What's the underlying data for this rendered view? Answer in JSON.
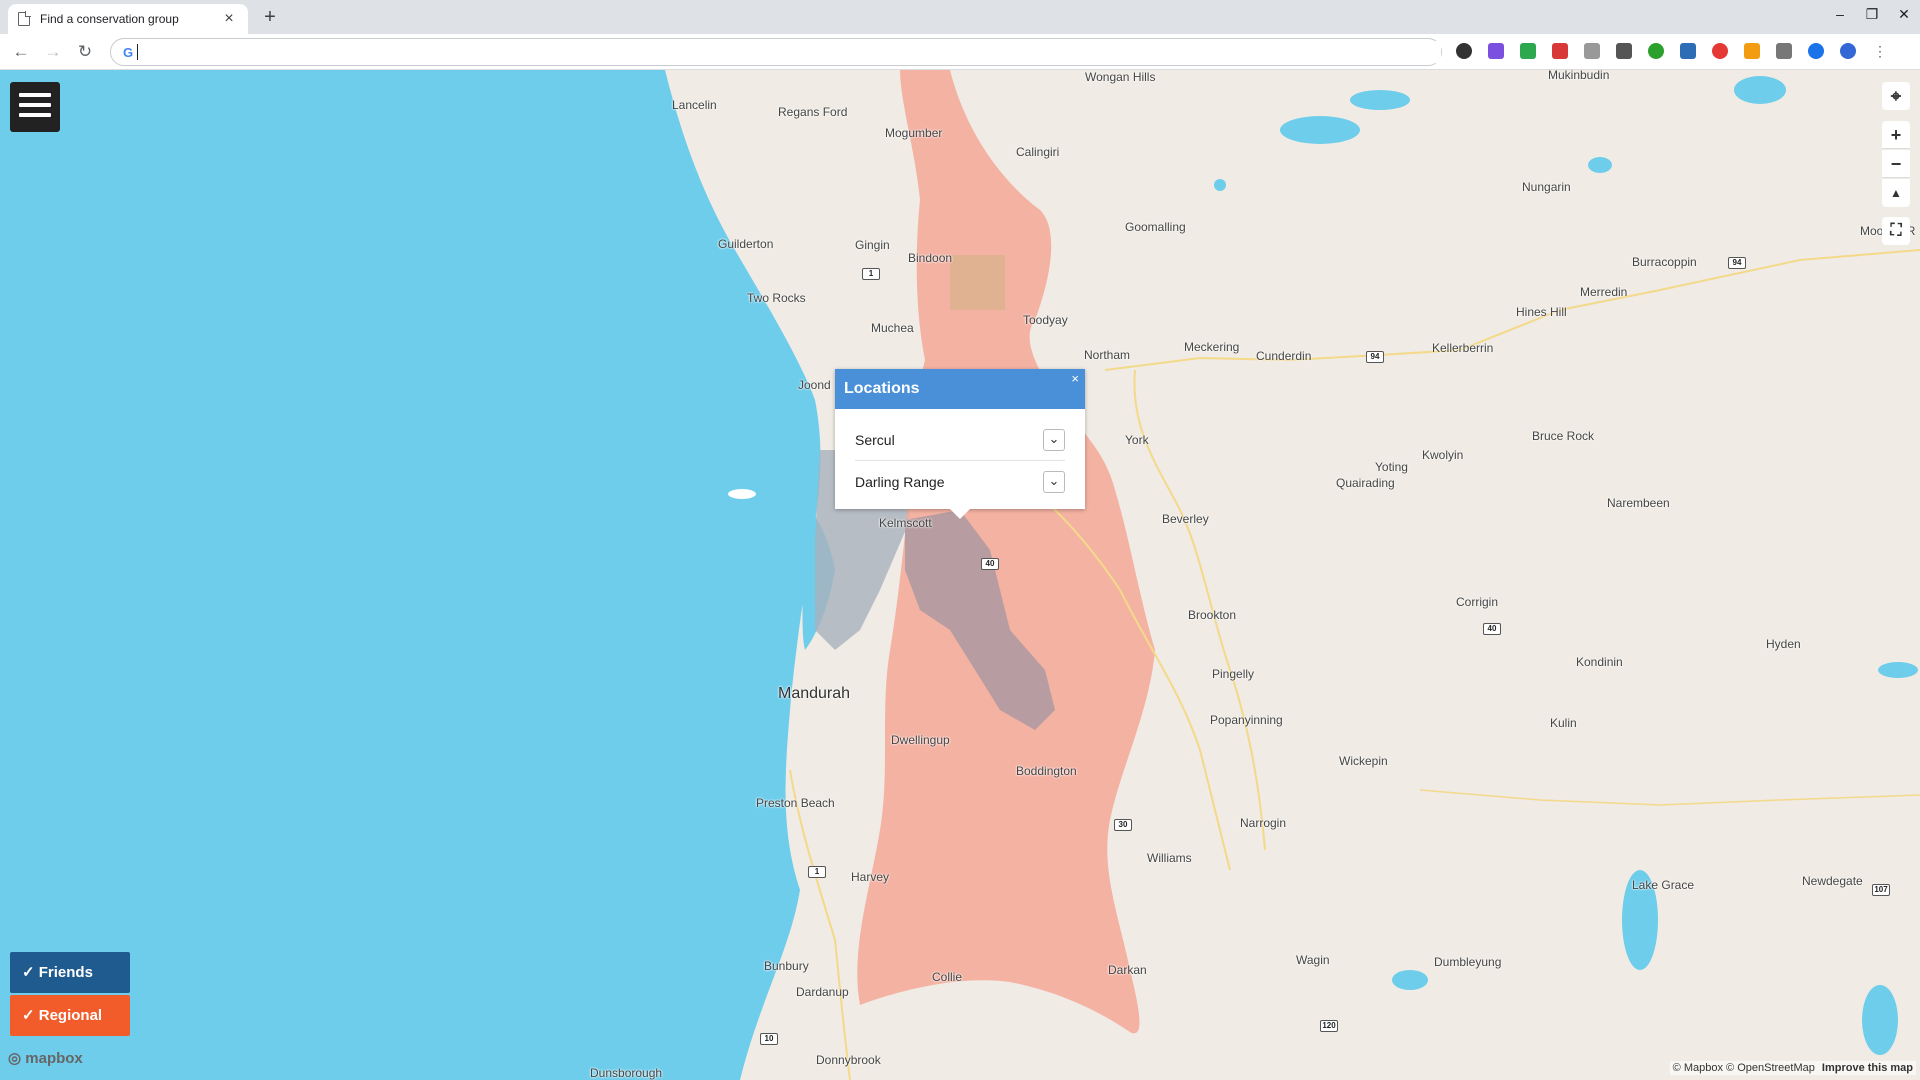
{
  "browser": {
    "tab_title": "Find a conservation group",
    "url_value": "",
    "window_controls": [
      "–",
      "❐",
      "✕"
    ]
  },
  "map": {
    "places": [
      {
        "name": "Wongan Hills"
      },
      {
        "name": "Mukinbudin"
      },
      {
        "name": "Lancelin"
      },
      {
        "name": "Regans Ford"
      },
      {
        "name": "Mogumber"
      },
      {
        "name": "Calingiri"
      },
      {
        "name": "Nungarin"
      },
      {
        "name": "Goomalling"
      },
      {
        "name": "Guilderton"
      },
      {
        "name": "Gingin"
      },
      {
        "name": "Bindoon"
      },
      {
        "name": "Burracoppin"
      },
      {
        "name": "Moorine R"
      },
      {
        "name": "Merredin"
      },
      {
        "name": "Hines Hill"
      },
      {
        "name": "Two Rocks"
      },
      {
        "name": "Muchea"
      },
      {
        "name": "Toodyay"
      },
      {
        "name": "Northam"
      },
      {
        "name": "Meckering"
      },
      {
        "name": "Cunderdin"
      },
      {
        "name": "Kellerberrin"
      },
      {
        "name": "Joond"
      },
      {
        "name": "York"
      },
      {
        "name": "Bruce Rock"
      },
      {
        "name": "Kwolyin"
      },
      {
        "name": "Yoting"
      },
      {
        "name": "Quairading"
      },
      {
        "name": "Narembeen"
      },
      {
        "name": "Beverley"
      },
      {
        "name": "Kelmscott"
      },
      {
        "name": "Corrigin"
      },
      {
        "name": "Brookton"
      },
      {
        "name": "Hyden"
      },
      {
        "name": "Kondinin"
      },
      {
        "name": "Pingelly"
      },
      {
        "name": "Mandurah"
      },
      {
        "name": "Popanyinning"
      },
      {
        "name": "Kulin"
      },
      {
        "name": "Dwellingup"
      },
      {
        "name": "Wickepin"
      },
      {
        "name": "Boddington"
      },
      {
        "name": "Preston Beach"
      },
      {
        "name": "Narrogin"
      },
      {
        "name": "Williams"
      },
      {
        "name": "Harvey"
      },
      {
        "name": "Lake Grace"
      },
      {
        "name": "Newdegate"
      },
      {
        "name": "Wagin"
      },
      {
        "name": "Dumbleyung"
      },
      {
        "name": "Bunbury"
      },
      {
        "name": "Collie"
      },
      {
        "name": "Darkan"
      },
      {
        "name": "Dardanup"
      },
      {
        "name": "Donnybrook"
      },
      {
        "name": "Dunsborough"
      }
    ],
    "shields": [
      "1",
      "94",
      "94",
      "40",
      "40",
      "30",
      "1",
      "107",
      "120",
      "10"
    ],
    "controls": [
      "locate-icon",
      "zoom-in-icon",
      "zoom-out-icon",
      "compass-icon",
      "fullscreen-icon"
    ]
  },
  "popup": {
    "title": "Locations",
    "close": "×",
    "items": [
      "Sercul",
      "Darling Range"
    ]
  },
  "filters": {
    "friends": "✓ Friends",
    "regional": "✓ Regional",
    "friends_color": "#1f5b8e",
    "regional_color": "#f25c2b"
  },
  "footer": {
    "logo": "mapbox",
    "attribution_1": "© Mapbox",
    "attribution_2": "© OpenStreetMap",
    "attribution_3": "Improve this map"
  },
  "colors": {
    "water": "#6ecdeb",
    "land": "#f0ebe4",
    "region_fill": "#f4a898",
    "urban": "#a9b2bd"
  }
}
